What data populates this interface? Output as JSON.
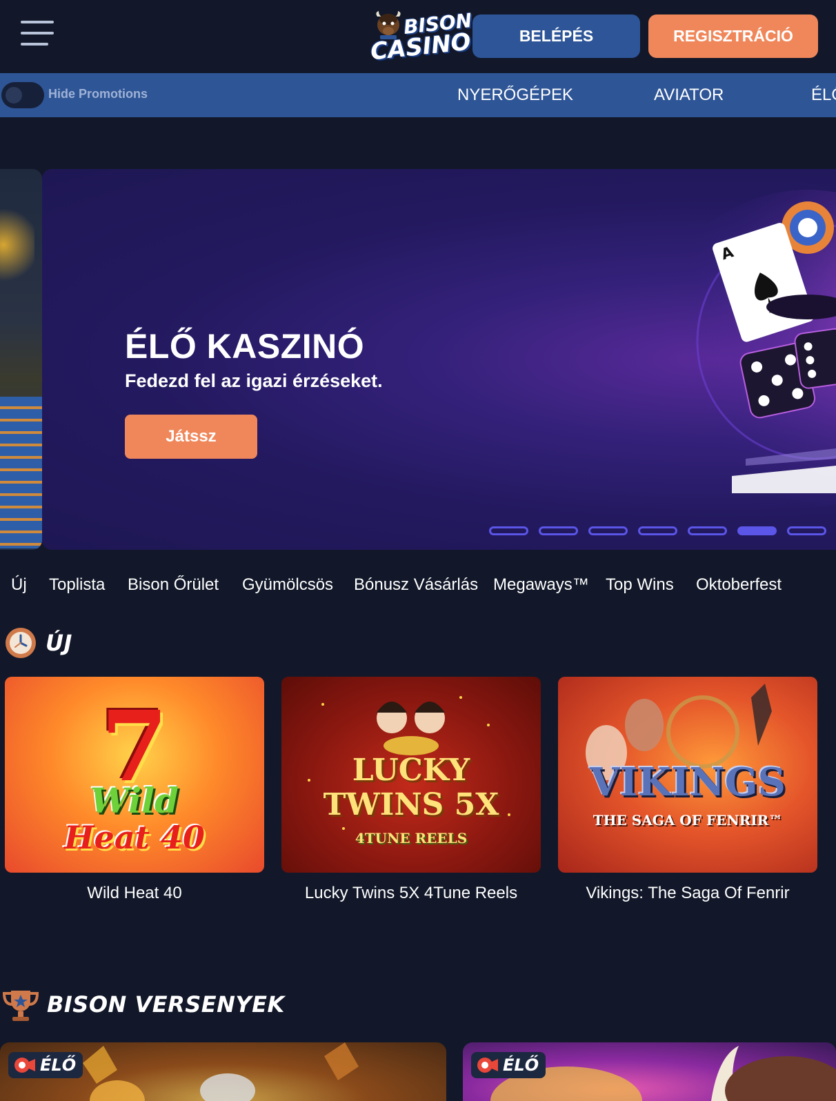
{
  "header": {
    "logo_line1": "BISON",
    "logo_line2": "CASINO",
    "login_label": "BELÉPÉS",
    "register_label": "REGISZTRÁCIÓ"
  },
  "navbar": {
    "toggle_label": "Hide Promotions",
    "items": [
      "NYERŐGÉPEK",
      "AVIATOR",
      "ÉLŐ"
    ]
  },
  "hero": {
    "title": "ÉLŐ KASZINÓ",
    "subtitle": "Fedezd fel az igazi érzéseket.",
    "cta_label": "Játssz",
    "slide_count": 7,
    "active_slide": 6
  },
  "categories": [
    "Új",
    "Toplista",
    "Bison Őrület",
    "Gyümölcsös",
    "Bónusz Vásárlás",
    "Megaways™",
    "Top Wins",
    "Oktoberfest"
  ],
  "new_section": {
    "title": "ÚJ",
    "games": [
      {
        "name": "Wild Heat 40",
        "art_line1": "7",
        "art_line2": "Wild",
        "art_line3": "Heat 40"
      },
      {
        "name": "Lucky Twins 5X 4Tune Reels",
        "art_line1": "LUCKY",
        "art_line2": "TWINS 5X",
        "art_line3": "4TUNE REELS"
      },
      {
        "name": "Vikings: The Saga Of Fenrir",
        "art_line1": "VIKINGS",
        "art_line2": "THE SAGA OF FENRIR™"
      }
    ]
  },
  "tournaments_section": {
    "title": "BISON VERSENYEK",
    "cards": [
      {
        "badge": "ÉLŐ"
      },
      {
        "badge": "ÉLŐ"
      }
    ]
  },
  "colors": {
    "background": "#121829",
    "navbar": "#2e5596",
    "login_button": "#2d5597",
    "accent_orange": "#f0875a",
    "carousel_dot": "#5b55e8"
  },
  "icons": [
    "menu-icon",
    "bison-logo-icon",
    "clock-icon",
    "trophy-icon",
    "live-camera-icon"
  ]
}
